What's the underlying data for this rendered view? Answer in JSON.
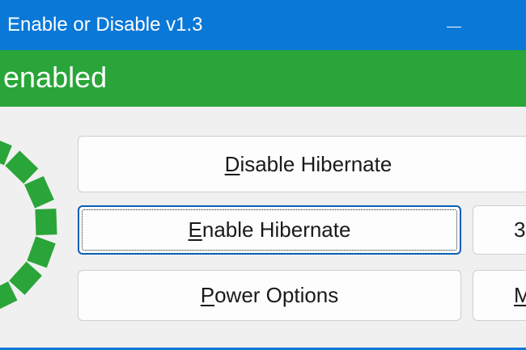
{
  "window": {
    "title": "Enable or Disable v1.3",
    "minimize_label": "—"
  },
  "status": {
    "text": "e enabled",
    "color": "#2aa539"
  },
  "buttons": {
    "disable_hibernate": {
      "mnemonic": "D",
      "rest": "isable Hibernate"
    },
    "enable_hibernate": {
      "mnemonic": "E",
      "rest": "nable Hibernate"
    },
    "power_options": {
      "mnemonic": "P",
      "rest": "ower Options"
    },
    "right_top_partial": "3",
    "right_bottom_partial": {
      "mnemonic": "M",
      "rest": ""
    }
  },
  "colors": {
    "titlebar": "#0a78d7",
    "banner": "#2aa539",
    "logo": "#2aa539"
  },
  "icons": {
    "logo": "dashed-circle-icon"
  }
}
